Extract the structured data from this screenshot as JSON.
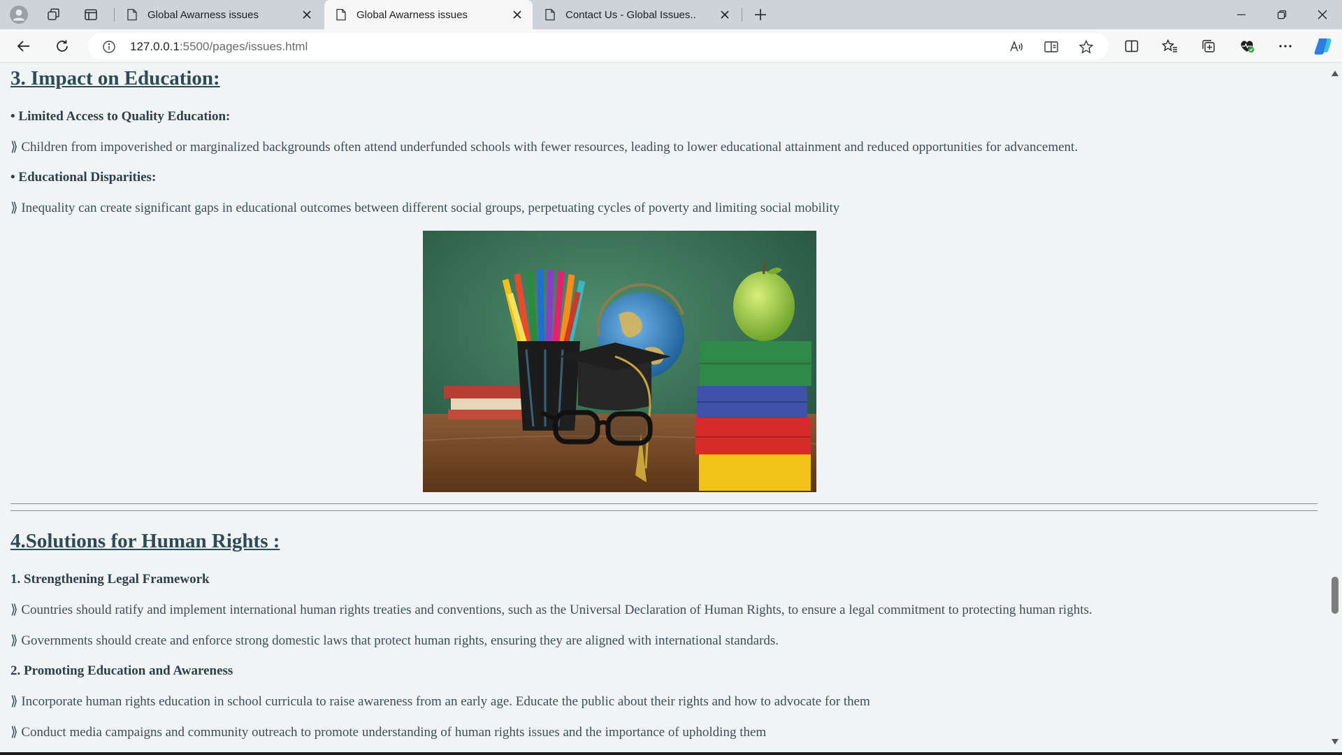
{
  "browser": {
    "tabs": [
      {
        "title": "Global Awarness issues",
        "active": false
      },
      {
        "title": "Global Awarness issues",
        "active": true
      },
      {
        "title": "Contact Us - Global Issues..",
        "active": false
      }
    ],
    "address": {
      "host": "127.0.0.1",
      "rest": ":5500/pages/issues.html"
    },
    "icons": {
      "profile": "profile-icon",
      "workspaces": "workspaces-icon",
      "tab_actions": "tab-actions-icon",
      "page": "page-icon",
      "close": "close-icon",
      "new_tab": "plus-icon",
      "minimize": "minimize-icon",
      "restore": "restore-icon",
      "back": "back-arrow-icon",
      "refresh": "refresh-icon",
      "info": "info-icon",
      "read_aloud": "read-aloud-icon",
      "immersive": "immersive-reader-icon",
      "favorite": "star-icon",
      "split": "split-screen-icon",
      "favorites": "favorites-icon",
      "collections": "collections-icon",
      "performance": "performance-icon",
      "more": "more-icon",
      "copilot": "copilot-icon"
    },
    "accent": "#1a73e8"
  },
  "page": {
    "education": {
      "heading": "3. Impact on Education:",
      "items": [
        {
          "title": "• Limited Access to Quality Education:",
          "text": "⟫ Children from impoverished or marginalized backgrounds often attend underfunded schools with fewer resources, leading to lower educational attainment and reduced opportunities for advancement."
        },
        {
          "title": "• Educational Disparities:",
          "text": "⟫ Inequality can create significant gaps in educational outcomes between different social groups, perpetuating cycles of poverty and limiting social mobility"
        }
      ]
    },
    "solutions": {
      "heading": "4.Solutions for Human Rights :",
      "items": [
        {
          "title": "1. Strengthening Legal Framework",
          "points": [
            "⟫ Countries should ratify and implement international human rights treaties and conventions, such as the Universal Declaration of Human Rights, to ensure a legal commitment to protecting human rights.",
            "⟫ Governments should create and enforce strong domestic laws that protect human rights, ensuring they are aligned with international standards."
          ]
        },
        {
          "title": "2. Promoting Education and Awareness",
          "points": [
            "⟫ Incorporate human rights education in school curricula to raise awareness from an early age. Educate the public about their rights and how to advocate for them",
            "⟫ Conduct media campaigns and community outreach to promote understanding of human rights issues and the importance of upholding them"
          ]
        }
      ]
    }
  }
}
